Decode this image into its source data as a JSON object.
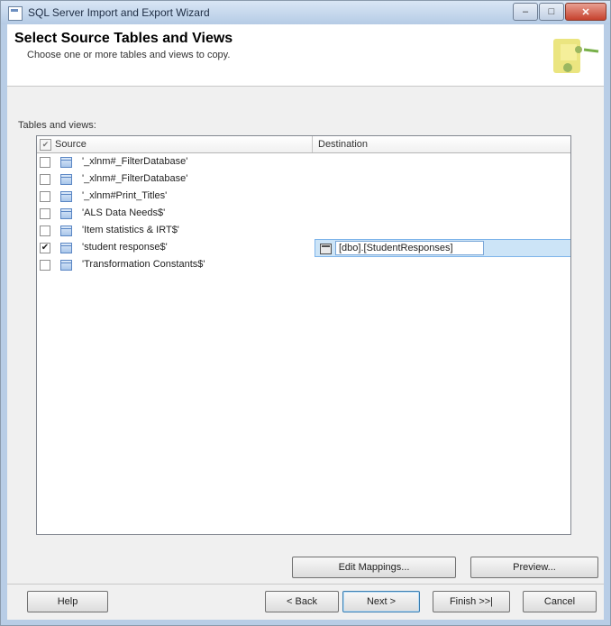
{
  "window": {
    "title": "SQL Server Import and Export Wizard",
    "controls": {
      "minimize": "–",
      "maximize": "□",
      "close": "✕"
    }
  },
  "header": {
    "title": "Select Source Tables and Views",
    "subtitle": "Choose one or more tables and views to copy."
  },
  "tables_label": "Tables and views:",
  "grid": {
    "columns": {
      "source": "Source",
      "destination": "Destination"
    },
    "rows": [
      {
        "source": "'_xlnm#_FilterDatabase'",
        "checked": false
      },
      {
        "source": "'_xlnm#_FilterDatabase'",
        "checked": false
      },
      {
        "source": "'_xlnm#Print_Titles'",
        "checked": false
      },
      {
        "source": "'ALS Data Needs$'",
        "checked": false
      },
      {
        "source": "'Item statistics & IRT$'",
        "checked": false
      },
      {
        "source": "'student response$'",
        "checked": true,
        "destination": "[dbo].[StudentResponses]"
      },
      {
        "source": "'Transformation Constants$'",
        "checked": false
      }
    ]
  },
  "buttons": {
    "edit_mappings": "Edit Mappings...",
    "preview": "Preview...",
    "help": "Help",
    "back": "< Back",
    "next": "Next >",
    "finish": "Finish >>|",
    "cancel": "Cancel"
  },
  "checkmark": "✔"
}
